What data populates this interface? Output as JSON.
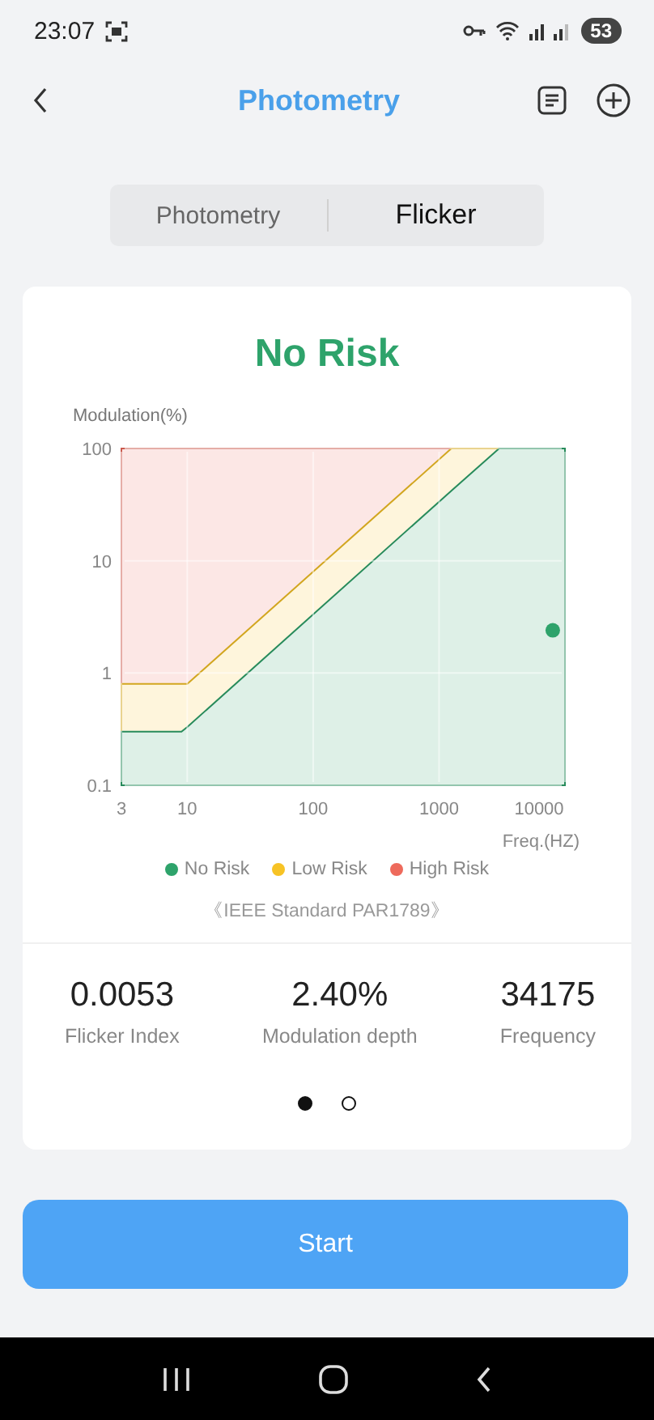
{
  "status_bar": {
    "time": "23:07",
    "battery": "53"
  },
  "header": {
    "title": "Photometry"
  },
  "tabs": [
    {
      "label": "Photometry",
      "selected": false
    },
    {
      "label": "Flicker",
      "selected": true
    }
  ],
  "result": {
    "title": "No Risk",
    "color": "#2ea36b"
  },
  "chart": {
    "ylabel": "Modulation(%)",
    "xlabel": "Freq.(HZ)",
    "yticks": [
      "100",
      "10",
      "1",
      "0.1"
    ],
    "xticks": [
      "3",
      "10",
      "100",
      "1000",
      "10000"
    ],
    "zones": [
      {
        "label": "No Risk",
        "color": "#2ea36b"
      },
      {
        "label": "Low Risk",
        "color": "#f7c325"
      },
      {
        "label": "High Risk",
        "color": "#ee6a5c"
      }
    ],
    "note": "《IEEE Standard PAR1789》"
  },
  "stats": [
    {
      "value": "0.0053",
      "label": "Flicker Index"
    },
    {
      "value": "2.40%",
      "label": "Modulation depth"
    },
    {
      "value": "34175",
      "label": "Frequency"
    }
  ],
  "pager": [
    {
      "selected": true
    },
    {
      "selected": false
    }
  ],
  "start_button": "Start"
}
